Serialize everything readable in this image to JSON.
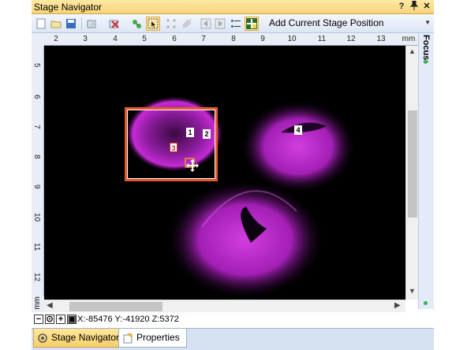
{
  "window": {
    "title": "Stage Navigator",
    "title_buttons": [
      "?",
      "−",
      "✕"
    ]
  },
  "toolbar": {
    "add_position_label": "Add Current Stage Position",
    "icons": [
      "new-icon",
      "open-icon",
      "save-icon",
      "edit-position-icon",
      "remove-position-icon",
      "add-point-icon",
      "select-tool-icon",
      "grid-points-icon",
      "tile-icon",
      "previous-icon",
      "next-icon",
      "list-icon",
      "stage-move-icon"
    ]
  },
  "focus_panel": {
    "label": "Focus:"
  },
  "ruler": {
    "horizontal_ticks": [
      "2",
      "3",
      "4",
      "5",
      "6",
      "7",
      "8",
      "9",
      "10",
      "11",
      "12",
      "13",
      "mm"
    ],
    "vertical_ticks": [
      "5",
      "6",
      "7",
      "8",
      "9",
      "10",
      "11",
      "12"
    ],
    "vertical_unit": "mm"
  },
  "markers": [
    {
      "label": "1",
      "style": "white"
    },
    {
      "label": "2",
      "style": "white"
    },
    {
      "label": "3",
      "style": "red"
    },
    {
      "label": "4",
      "style": "white"
    }
  ],
  "status": {
    "coordinates": "X:-85476 Y:-41920 Z:5372",
    "zoom_buttons": [
      "−",
      "⊙",
      "+",
      "▣"
    ]
  },
  "tabs": [
    {
      "label": "Stage Navigator",
      "active": true,
      "icon": "stage-navigator-icon"
    },
    {
      "label": "Properties",
      "active": false,
      "icon": "properties-icon"
    }
  ],
  "colors": {
    "fluorescence": "#c020d0",
    "roi_border": "#e2592b",
    "title_bar": "#f8d47a"
  }
}
